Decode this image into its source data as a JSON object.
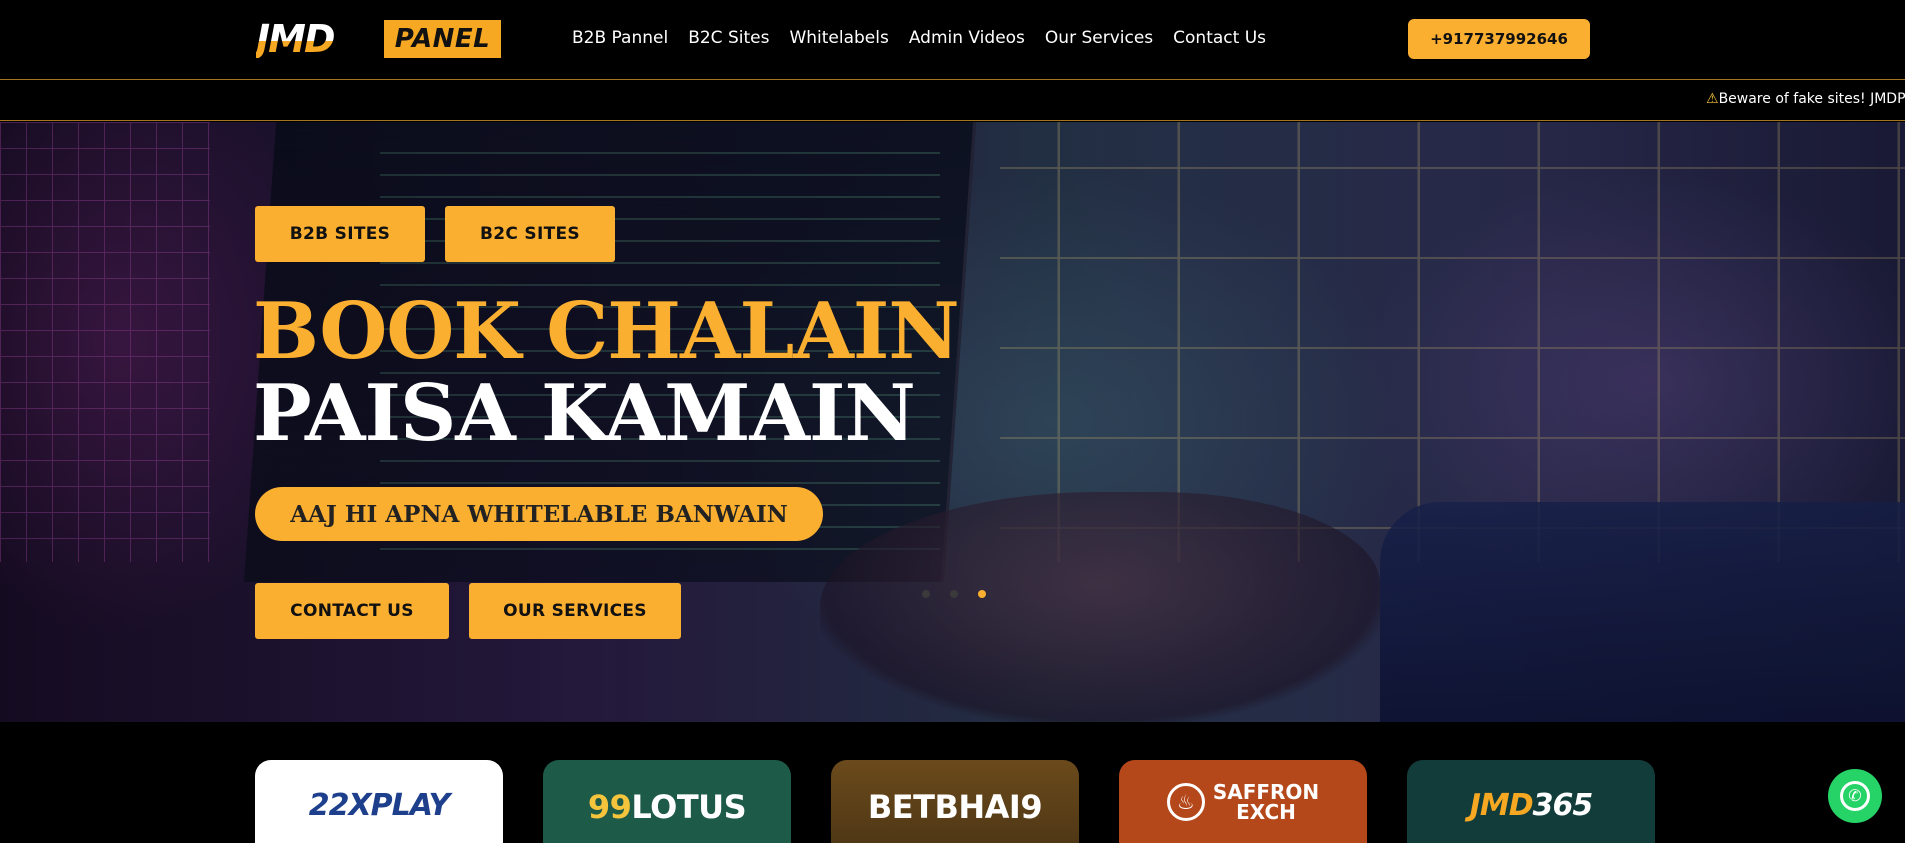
{
  "header": {
    "logo": {
      "left": "JMD",
      "right": "PANEL"
    },
    "nav": [
      "B2B Pannel",
      "B2C Sites",
      "Whitelabels",
      "Admin Videos",
      "Our Services",
      "Contact Us"
    ],
    "phone": "+917737992646"
  },
  "marquee": {
    "icon": "warning-icon",
    "text": "Beware of fake sites! JMDP"
  },
  "hero": {
    "top_buttons": [
      "B2B SITES",
      "B2C SITES"
    ],
    "title_line1": "BOOK CHALAIN",
    "title_line2": "PAISA KAMAIN",
    "tagline": "AAJ HI APNA WHITELABLE BANWAIN",
    "bottom_buttons": [
      "CONTACT US",
      "OUR SERVICES"
    ],
    "slides_total": 3,
    "slide_active": 3
  },
  "cards": {
    "items": [
      {
        "name": "22XPLAY"
      },
      {
        "prefix": "99",
        "rest": "LOTUS"
      },
      {
        "name": "BETBHAI9"
      },
      {
        "line1": "SAFFRON",
        "line2": "EXCH"
      },
      {
        "prefix": "JMD",
        "rest": "365"
      }
    ]
  },
  "colors": {
    "accent": "#fbaf30",
    "background": "#000000",
    "whatsapp": "#25d366"
  },
  "floating": {
    "icon": "whatsapp-icon"
  }
}
